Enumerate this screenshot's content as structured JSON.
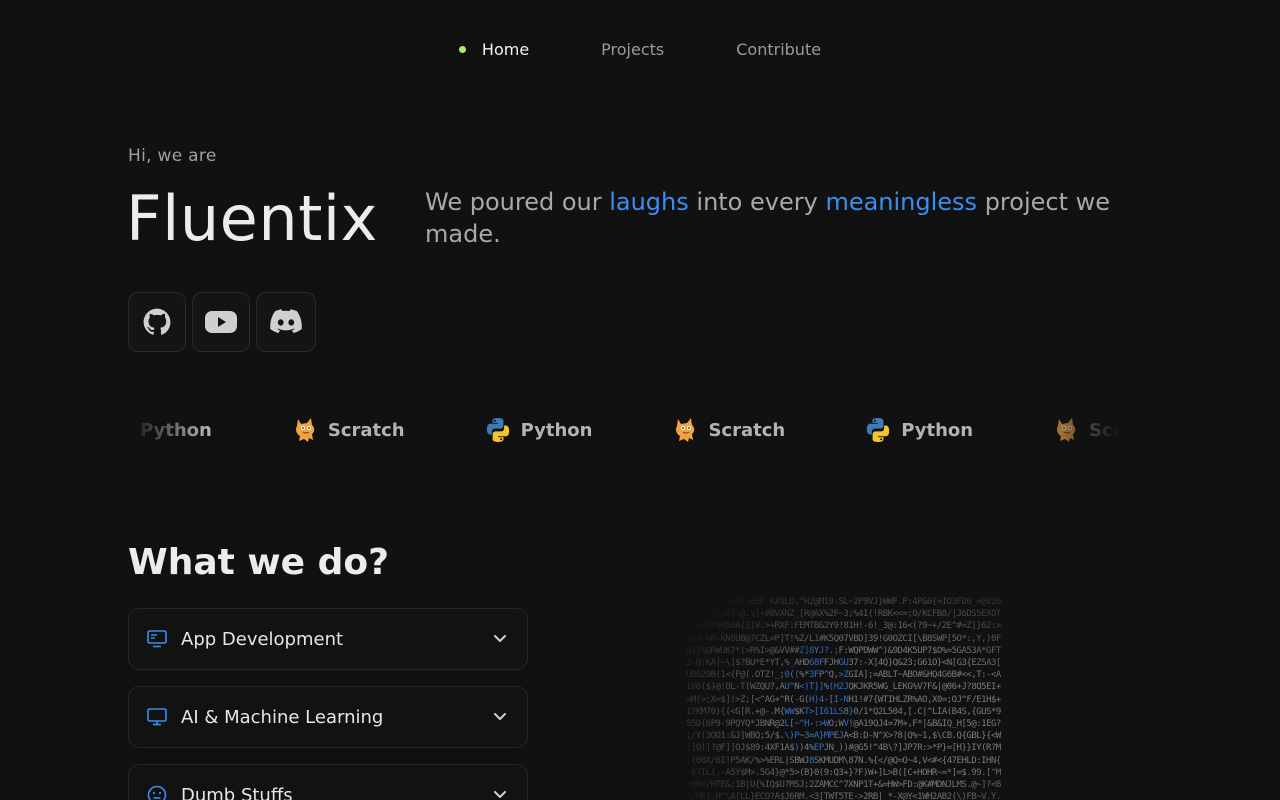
{
  "nav": {
    "items": [
      {
        "label": "Home",
        "active": true
      },
      {
        "label": "Projects",
        "active": false
      },
      {
        "label": "Contribute",
        "active": false
      }
    ]
  },
  "hero": {
    "greeting": "Hi, we are",
    "brand": "Fluentix",
    "tagline": {
      "part1": "We poured our ",
      "highlight1": "laughs",
      "part2": " into every ",
      "highlight2": "meaningless",
      "part3": " project we made."
    },
    "socials": [
      {
        "icon": "github-icon"
      },
      {
        "icon": "youtube-icon"
      },
      {
        "icon": "discord-icon"
      }
    ]
  },
  "tech_marquee": {
    "items": [
      {
        "label": "Python",
        "icon": "python-icon"
      },
      {
        "label": "Scratch",
        "icon": "scratch-icon"
      },
      {
        "label": "Python",
        "icon": "python-icon"
      },
      {
        "label": "Scratch",
        "icon": "scratch-icon"
      },
      {
        "label": "Python",
        "icon": "python-icon"
      },
      {
        "label": "Scratch",
        "icon": "scratch-icon"
      }
    ]
  },
  "what_we_do": {
    "title": "What we do?",
    "items": [
      {
        "label": "App Development",
        "icon": "app-window-icon"
      },
      {
        "label": "AI & Machine Learning",
        "icon": "monitor-icon"
      },
      {
        "label": "Dumb Stuffs",
        "icon": "smiley-icon"
      }
    ]
  },
  "colors": {
    "background": "#111112",
    "accent_blue": "#3b8ef0",
    "active_dot": "#a6ef67"
  }
}
